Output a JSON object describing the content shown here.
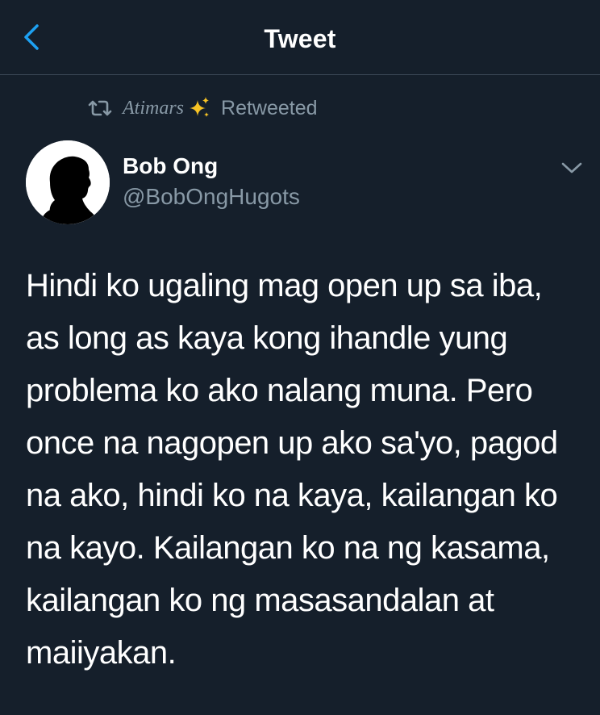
{
  "header": {
    "title": "Tweet",
    "back_icon": "chevron-left-icon"
  },
  "retweet": {
    "user": "Atimars",
    "emoji_icon": "sparkles-icon",
    "label": "Retweeted",
    "icon": "retweet-icon"
  },
  "tweet": {
    "author": {
      "name": "Bob Ong",
      "handle": "@BobOngHugots",
      "avatar_icon": "silhouette-avatar"
    },
    "menu_icon": "chevron-down-icon",
    "text": "Hindi ko ugaling mag open up sa iba, as long as kaya kong ihandle yung problema ko ako nalang muna. Pero once na nagopen up ako sa'yo, pagod na ako, hindi ko na kaya, kailangan ko na kayo. Kailangan ko na ng kasama, kailangan ko ng masasandalan at maiiyakan."
  },
  "colors": {
    "background": "#151f2b",
    "accent": "#1da1f2",
    "secondary_text": "#8899a6",
    "primary_text": "#ffffff",
    "divider": "#3a4654"
  }
}
